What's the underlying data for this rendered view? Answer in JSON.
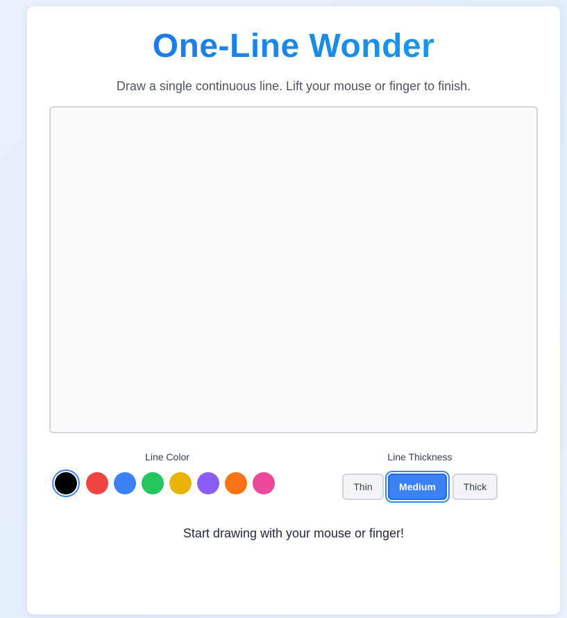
{
  "header": {
    "title": "One-Line Wonder",
    "subtitle": "Draw a single continuous line. Lift your mouse or finger to finish."
  },
  "color_picker": {
    "label": "Line Color",
    "selected": "black",
    "swatches": [
      {
        "name": "black",
        "hex": "#000000"
      },
      {
        "name": "red",
        "hex": "#ef4444"
      },
      {
        "name": "blue",
        "hex": "#3b82f6"
      },
      {
        "name": "green",
        "hex": "#22c55e"
      },
      {
        "name": "yellow",
        "hex": "#eab308"
      },
      {
        "name": "purple",
        "hex": "#8b5cf6"
      },
      {
        "name": "orange",
        "hex": "#f97316"
      },
      {
        "name": "pink",
        "hex": "#ec4899"
      }
    ]
  },
  "thickness": {
    "label": "Line Thickness",
    "selected": "Medium",
    "options": [
      "Thin",
      "Medium",
      "Thick"
    ]
  },
  "status": "Start drawing with your mouse or finger!",
  "colors": {
    "accent": "#3b82f6",
    "title_gradient_start": "#1e6ee8",
    "title_gradient_end": "#17a3e6",
    "canvas_bg": "#f8fafc"
  }
}
